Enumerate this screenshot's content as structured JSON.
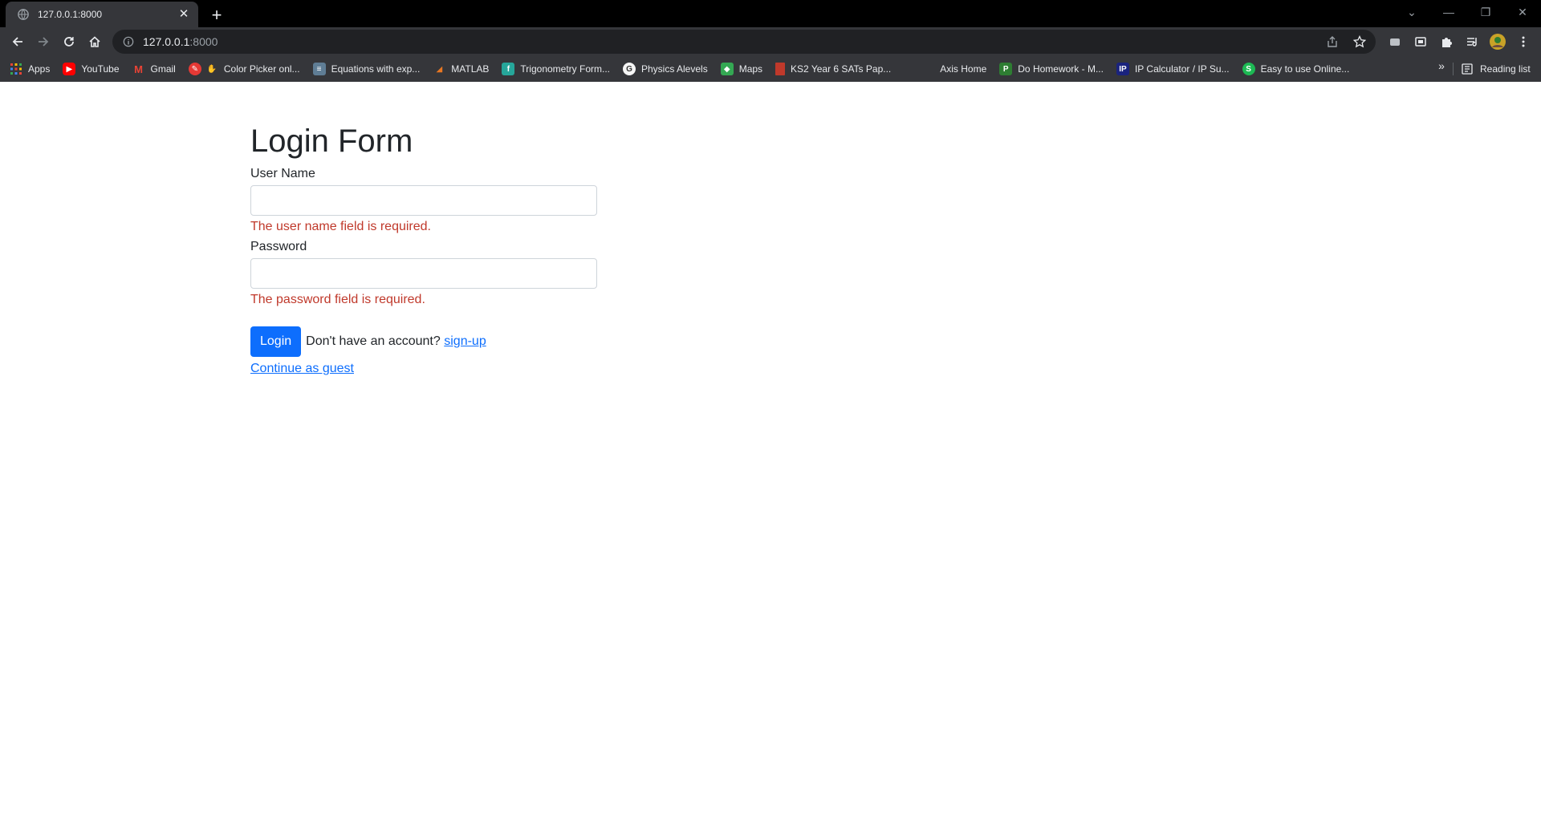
{
  "browser": {
    "tab_title": "127.0.0.1:8000",
    "new_tab": "+",
    "url_host": "127.0.0.1",
    "url_port": ":8000",
    "bookmarks": [
      {
        "label": "Apps",
        "icon": "apps-grid-icon",
        "color": "#ea4335"
      },
      {
        "label": "YouTube",
        "icon": "youtube-icon",
        "color": "#ff0000"
      },
      {
        "label": "Gmail",
        "icon": "gmail-icon",
        "color": "#ea4335"
      },
      {
        "label": "Color Picker onl...",
        "icon": "color-picker-icon",
        "color": "#e53935"
      },
      {
        "label": "Equations with exp...",
        "icon": "equations-icon",
        "color": "#5f7d95"
      },
      {
        "label": "MATLAB",
        "icon": "matlab-icon",
        "color": "#e87722"
      },
      {
        "label": "Trigonometry Form...",
        "icon": "trig-icon",
        "color": "#26a69a"
      },
      {
        "label": "Physics Alevels",
        "icon": "physics-icon",
        "color": "#333333"
      },
      {
        "label": "Maps",
        "icon": "maps-icon",
        "color": "#34a853"
      },
      {
        "label": "KS2 Year 6 SATs Pap...",
        "icon": "bookmark-icon",
        "color": "#c0392b"
      },
      {
        "label": "Axis Home",
        "icon": "axis-icon",
        "color": "#35363a"
      },
      {
        "label": "Do Homework - M...",
        "icon": "homework-icon",
        "color": "#2e7d32"
      },
      {
        "label": "IP Calculator / IP Su...",
        "icon": "ip-icon",
        "color": "#1a237e"
      },
      {
        "label": "Easy to use Online...",
        "icon": "easy-icon",
        "color": "#1db954"
      }
    ],
    "reading_list": "Reading list"
  },
  "form": {
    "title": "Login Form",
    "username_label": "User Name",
    "username_value": "",
    "username_error": "The user name field is required.",
    "password_label": "Password",
    "password_value": "",
    "password_error": "The password field is required.",
    "login_button": "Login",
    "signup_prompt": "Don't have an account?",
    "signup_link": "sign-up",
    "guest_link": "Continue as guest"
  }
}
